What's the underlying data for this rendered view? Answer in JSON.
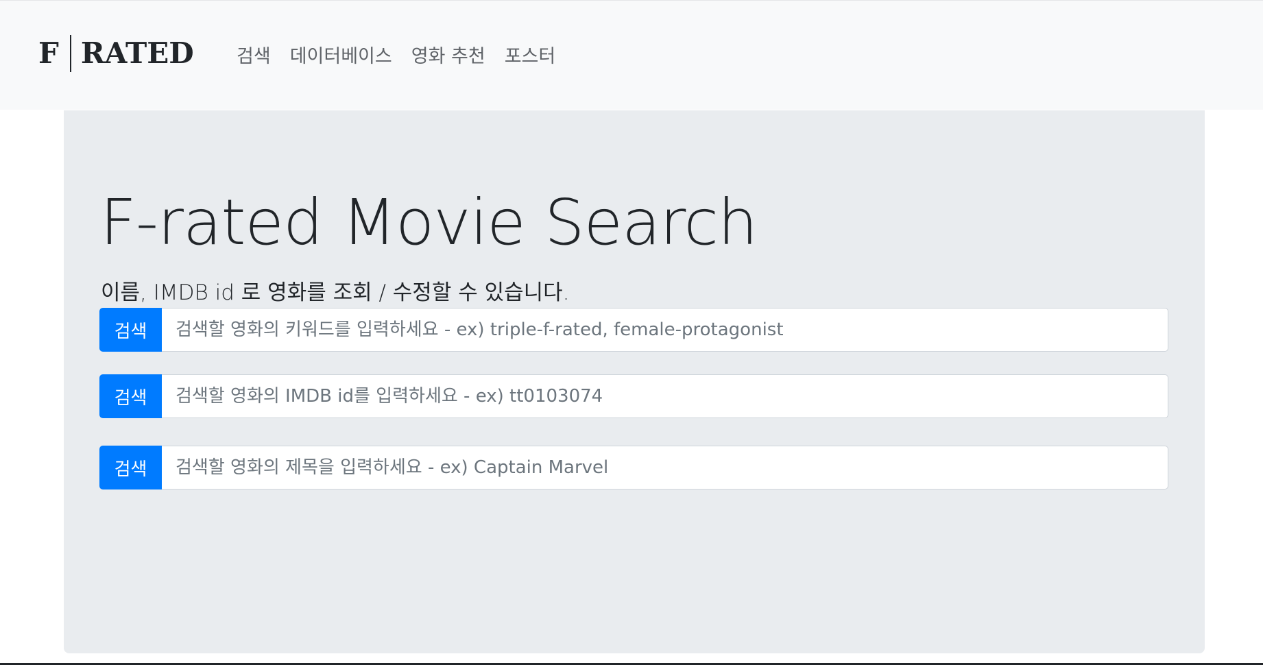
{
  "brand": {
    "letter": "F",
    "word": "RATED"
  },
  "nav": {
    "items": [
      {
        "label": "검색"
      },
      {
        "label": "데이터베이스"
      },
      {
        "label": "영화 추천"
      },
      {
        "label": "포스터"
      }
    ]
  },
  "hero": {
    "title": "F-rated Movie Search",
    "subtitle": "이름, IMDB id 로 영화를 조회 / 수정할 수 있습니다."
  },
  "searches": [
    {
      "button_label": "검색",
      "placeholder": "검색할 영화의 키워드를 입력하세요 - ex) triple-f-rated, female-protagonist",
      "value": ""
    },
    {
      "button_label": "검색",
      "placeholder": "검색할 영화의 IMDB id를 입력하세요 - ex) tt0103074",
      "value": ""
    },
    {
      "button_label": "검색",
      "placeholder": "검색할 영화의 제목을 입력하세요 - ex) Captain Marvel",
      "value": ""
    }
  ],
  "colors": {
    "primary": "#007bff",
    "navbar_bg": "#f8f9fa",
    "jumbotron_bg": "#e9ecef"
  }
}
